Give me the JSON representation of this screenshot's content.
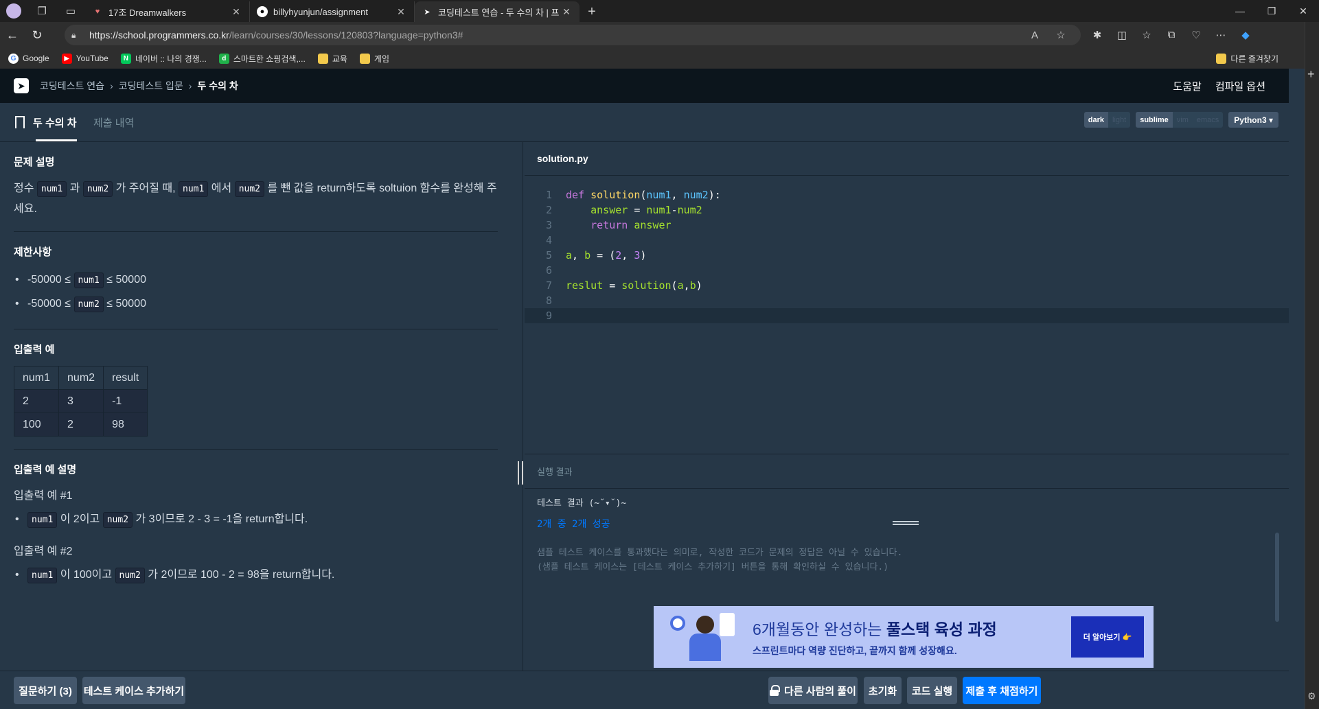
{
  "browser": {
    "tabs": [
      {
        "title": "17조 Dreamwalkers",
        "icon": "map-pin-icon",
        "active": false
      },
      {
        "title": "billyhyunjun/assignment",
        "icon": "github-icon",
        "active": false
      },
      {
        "title": "코딩테스트 연습 - 두 수의 차 | 프",
        "icon": "programmers-icon",
        "active": true
      }
    ],
    "new_tab_label": "+",
    "url_host": "https://school.programmers.co.kr",
    "url_path": "/learn/courses/30/lessons/120803?language=python3#",
    "bookmarks": [
      {
        "label": "Google",
        "icon": "google-icon",
        "color": "#ffffff"
      },
      {
        "label": "YouTube",
        "icon": "youtube-icon",
        "color": "#ff0000"
      },
      {
        "label": "네이버 :: 나의 경쟁...",
        "icon": "naver-icon",
        "color": "#03c75a"
      },
      {
        "label": "스마트한 쇼핑검색,...",
        "icon": "danawa-icon",
        "color": "#20b14a"
      },
      {
        "label": "교육",
        "icon": "folder-icon",
        "color": "#f2c94c"
      },
      {
        "label": "게임",
        "icon": "folder-icon",
        "color": "#f2c94c"
      }
    ],
    "other_bookmarks": "다른 즐겨찾기"
  },
  "header": {
    "breadcrumb": [
      "코딩테스트 연습",
      "코딩테스트 입문"
    ],
    "current": "두 수의 차",
    "help": "도움말",
    "compile_options": "컴파일 옵션"
  },
  "tabs": {
    "problem": "두 수의 차",
    "submissions": "제출 내역"
  },
  "editor_options": {
    "theme": [
      "dark",
      "light"
    ],
    "keymap": [
      "sublime",
      "vim",
      "emacs"
    ],
    "language": "Python3 ▾"
  },
  "problem": {
    "desc_title": "문제 설명",
    "desc_p1": "정수",
    "desc_code1": "num1",
    "desc_p2": "과",
    "desc_code2": "num2",
    "desc_p3": "가 주어질 때,",
    "desc_code3": "num1",
    "desc_p4": "에서",
    "desc_code4": "num2",
    "desc_p5": "를 뺀 값을 return하도록 soltuion 함수를 완성해 주세요.",
    "limits_title": "제한사항",
    "limits": [
      {
        "pre": "-50000 ≤",
        "code": "num1",
        "post": "≤ 50000"
      },
      {
        "pre": "-50000 ≤",
        "code": "num2",
        "post": "≤ 50000"
      }
    ],
    "io_title": "입출력 예",
    "io_headers": [
      "num1",
      "num2",
      "result"
    ],
    "io_rows": [
      [
        "2",
        "3",
        "-1"
      ],
      [
        "100",
        "2",
        "98"
      ]
    ],
    "io_desc_title": "입출력 예 설명",
    "ex1_title": "입출력 예 #1",
    "ex1": {
      "c1": "num1",
      "t1": "이 2이고",
      "c2": "num2",
      "t2": "가 3이므로 2 - 3 = -1을 return합니다."
    },
    "ex2_title": "입출력 예 #2",
    "ex2": {
      "c1": "num1",
      "t1": "이 100이고",
      "c2": "num2",
      "t2": "가 2이므로 100 - 2 = 98을 return합니다."
    }
  },
  "editor": {
    "filename": "solution.py",
    "line_numbers": [
      "1",
      "2",
      "3",
      "4",
      "5",
      "6",
      "7",
      "8",
      "9"
    ]
  },
  "result": {
    "title": "실행 결과",
    "line1": "테스트 결과 (~˘▾˘)~",
    "line2": "2개 중 2개 성공",
    "line3": "샘플 테스트 케이스를 통과했다는 의미로, 작성한 코드가 문제의 정답은 아닐 수 있습니다.",
    "line4": "(샘플 테스트 케이스는 [테스트 케이스 추가하기] 버튼을 통해 확인하실 수 있습니다.)"
  },
  "ad": {
    "headline_a": "6개월동안 완성하는 ",
    "headline_b": "풀스택 육성 과정",
    "sub": "스프린트마다 역량 진단하고, 끝까지 함께 성장해요.",
    "cta": "더 알아보기 👉"
  },
  "bottom": {
    "ask": "질문하기 (3)",
    "add_tc": "테스트 케이스 추가하기",
    "others": "다른 사람의 풀이",
    "reset": "초기화",
    "run": "코드 실행",
    "submit": "제출 후 채점하기"
  }
}
